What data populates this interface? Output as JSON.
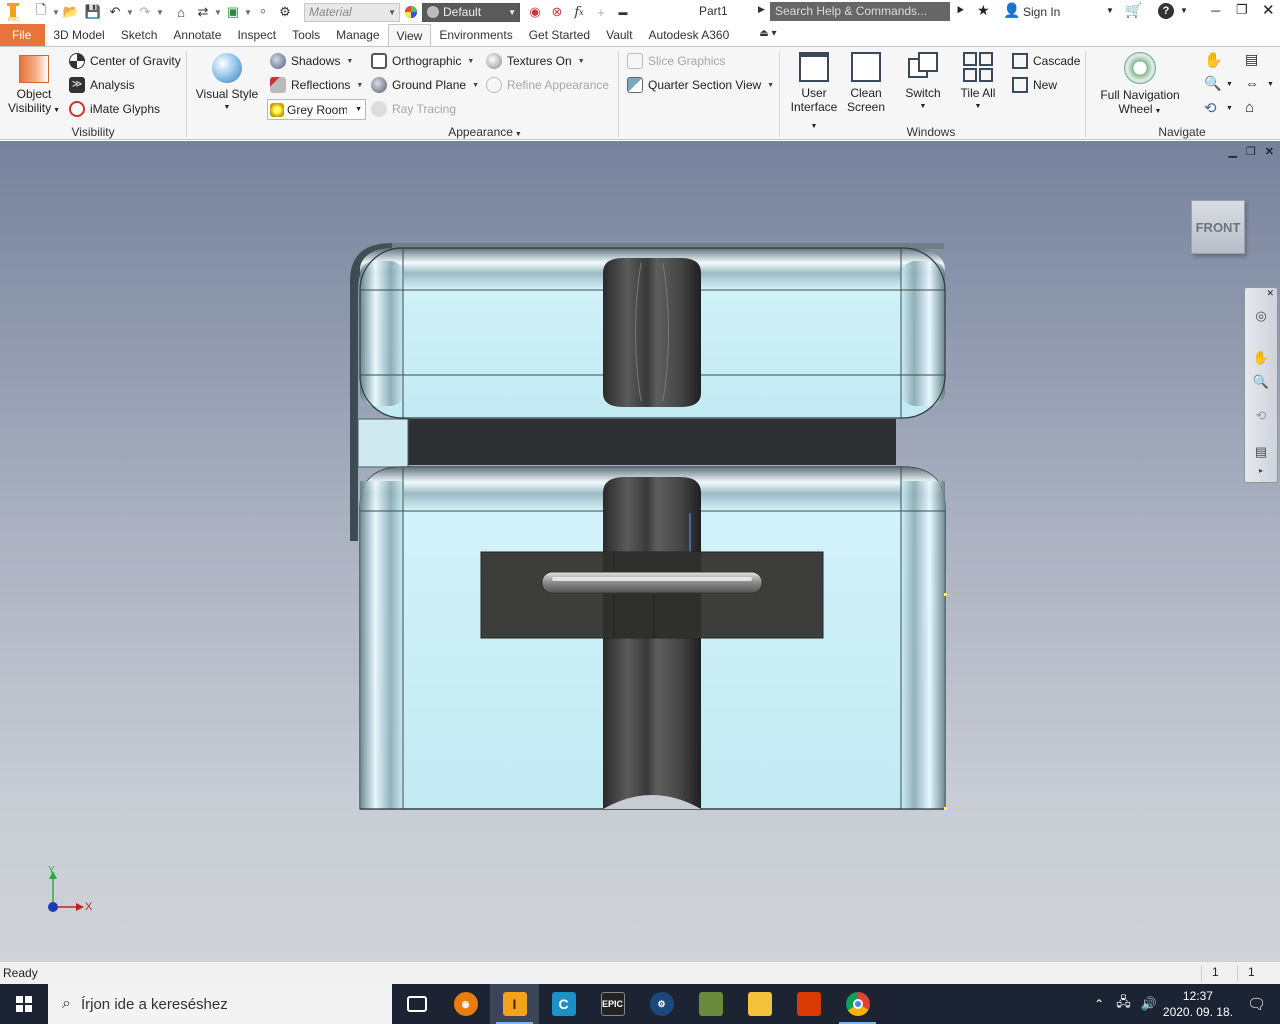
{
  "qat": {
    "material_placeholder": "Material",
    "appearance_value": "Default",
    "doc_title": "Part1",
    "search_placeholder": "Search Help & Commands...",
    "sign_in": "Sign In"
  },
  "tabs": [
    "File",
    "3D Model",
    "Sketch",
    "Annotate",
    "Inspect",
    "Tools",
    "Manage",
    "View",
    "Environments",
    "Get Started",
    "Vault",
    "Autodesk A360"
  ],
  "active_tab": "View",
  "ribbon": {
    "visibility": {
      "title": "Visibility",
      "object_visibility": [
        "Object",
        "Visibility"
      ],
      "center_of_gravity": "Center of Gravity",
      "analysis": "Analysis",
      "imate_glyphs": "iMate Glyphs"
    },
    "appearance": {
      "title": "Appearance",
      "visual_style": "Visual Style",
      "shadows": "Shadows",
      "reflections": "Reflections",
      "lighting_value": "Grey Room",
      "orthographic": "Orthographic",
      "ground_plane": "Ground Plane",
      "ray_tracing": "Ray Tracing",
      "textures_on": "Textures On",
      "refine_appearance": "Refine Appearance",
      "slice_graphics": "Slice Graphics",
      "quarter_section_view": "Quarter Section View"
    },
    "windows": {
      "title": "Windows",
      "user_interface": [
        "User",
        "Interface"
      ],
      "clean_screen": [
        "Clean",
        "Screen"
      ],
      "switch": "Switch",
      "tile_all": "Tile All",
      "cascade": "Cascade",
      "new": "New"
    },
    "navigate": {
      "title": "Navigate",
      "full_navigation_wheel": [
        "Full Navigation",
        "Wheel"
      ]
    }
  },
  "viewport": {
    "viewcube_label": "FRONT",
    "axis_x": "X",
    "axis_y": "Y"
  },
  "status": {
    "text": "Ready",
    "cell1": "1",
    "cell2": "1"
  },
  "taskbar": {
    "search_placeholder": "Írjon ide a kereséshez",
    "epic_label": "EPIC",
    "time": "12:37",
    "date": "2020. 09. 18."
  },
  "colors": {
    "file_tab": "#e8743b",
    "taskbar": "#1c2434",
    "part_highlight": "#c4f0f6"
  }
}
